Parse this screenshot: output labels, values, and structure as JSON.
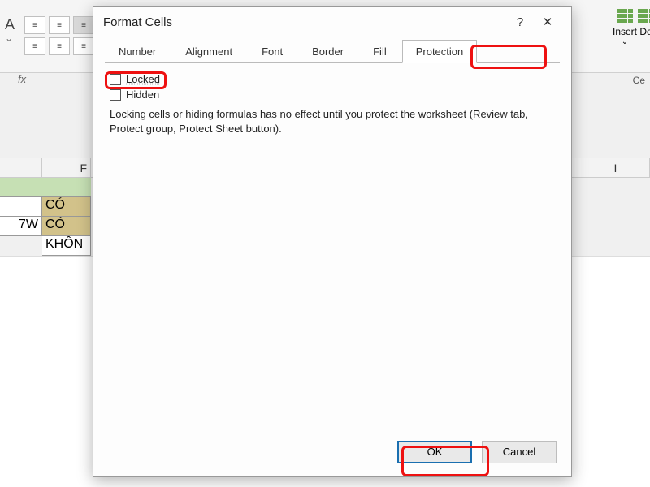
{
  "ribbon": {
    "font_letter": "A",
    "insert_label": "Insert",
    "delete_label": "De",
    "cells_group_label": "Ce"
  },
  "sheet": {
    "col_partial_left": "F",
    "col_I": "I",
    "row2_partial": "7W",
    "cells": [
      "CÓ",
      "CÓ",
      "KHÔN"
    ]
  },
  "dialog": {
    "title": "Format Cells",
    "help": "?",
    "close": "✕",
    "tabs": {
      "number": "Number",
      "alignment": "Alignment",
      "font": "Font",
      "border": "Border",
      "fill": "Fill",
      "protection": "Protection"
    },
    "locked_label": "Locked",
    "hidden_label": "Hidden",
    "description": "Locking cells or hiding formulas has no effect until you protect the worksheet (Review tab, Protect group, Protect Sheet button).",
    "ok": "OK",
    "cancel": "Cancel"
  }
}
